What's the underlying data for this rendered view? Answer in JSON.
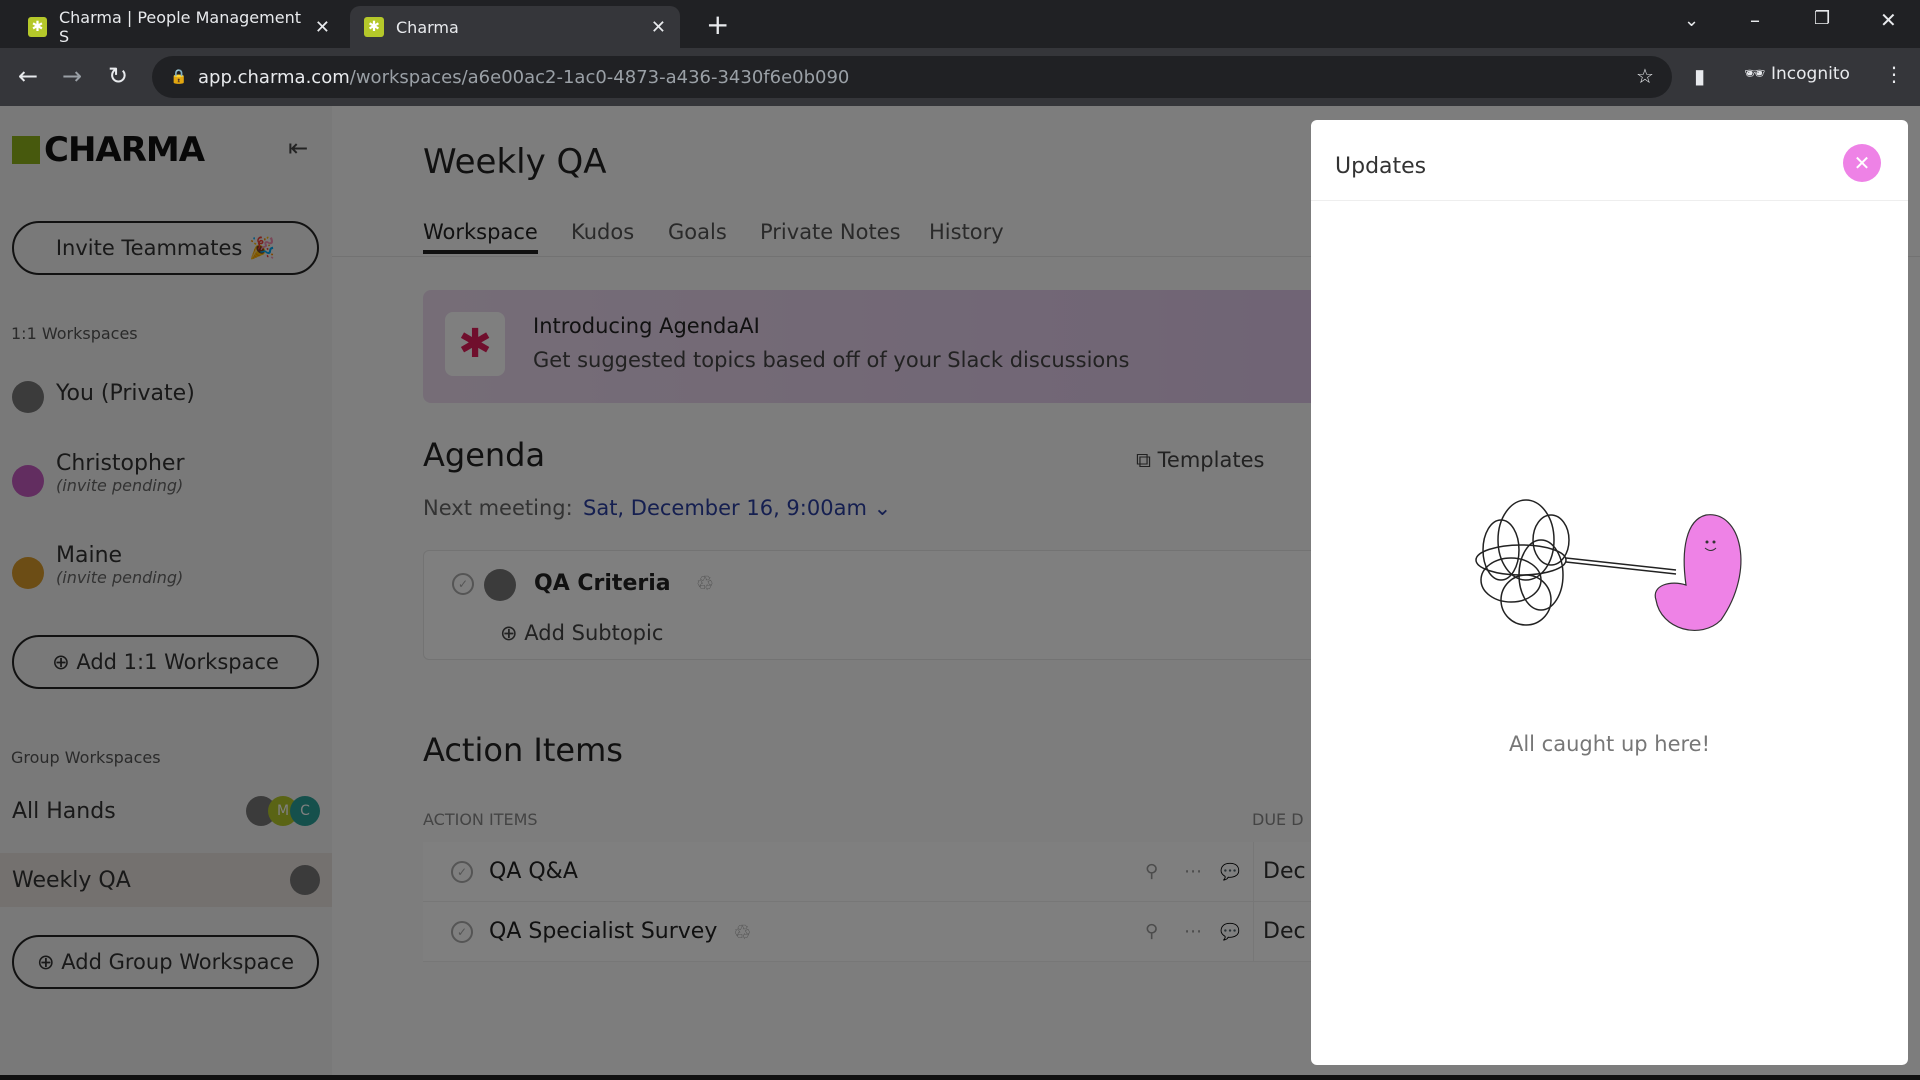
{
  "browser": {
    "tabs": [
      {
        "title": "Charma | People Management S",
        "active": false
      },
      {
        "title": "Charma",
        "active": true
      }
    ],
    "url_host": "app.charma.com",
    "url_path": "/workspaces/a6e00ac2-1ac0-4873-a436-3430f6e0b090",
    "profile": "Incognito"
  },
  "sidebar": {
    "logo": "CHARMA",
    "invite_label": "Invite Teammates 🎉",
    "one_on_one_heading": "1:1 Workspaces",
    "one_on_one": [
      {
        "name": "You (Private)",
        "status": ""
      },
      {
        "name": "Christopher",
        "status": "(invite pending)"
      },
      {
        "name": "Maine",
        "status": "(invite pending)"
      }
    ],
    "add_one_on_one": "Add 1:1 Workspace",
    "group_heading": "Group Workspaces",
    "groups": [
      {
        "name": "All Hands",
        "avatars": [
          "",
          "M",
          "C"
        ]
      },
      {
        "name": "Weekly QA",
        "avatars": [
          ""
        ]
      }
    ],
    "add_group": "Add Group Workspace"
  },
  "main": {
    "title": "Weekly QA",
    "tabs": [
      "Workspace",
      "Kudos",
      "Goals",
      "Private Notes",
      "History"
    ],
    "active_tab": "Workspace",
    "banner": {
      "title": "Introducing AgendaAI",
      "subtitle": "Get suggested topics based off of your Slack discussions"
    },
    "agenda": {
      "heading": "Agenda",
      "templates": "Templates",
      "next_label": "Next meeting:",
      "next_value": "Sat, December 16, 9:00am",
      "topic": "QA Criteria",
      "add_subtopic": "Add Subtopic"
    },
    "action_items": {
      "heading": "Action Items",
      "col_items": "ACTION ITEMS",
      "col_due": "DUE D",
      "rows": [
        {
          "title": "QA Q&A",
          "due": "Dec"
        },
        {
          "title": "QA Specialist Survey",
          "due": "Dec"
        }
      ]
    }
  },
  "updates": {
    "title": "Updates",
    "empty": "All caught up here!"
  },
  "colors": {
    "accent_pink": "#ee82e6",
    "brand_green": "#8fb31a",
    "link_blue": "#2b3fa0"
  }
}
